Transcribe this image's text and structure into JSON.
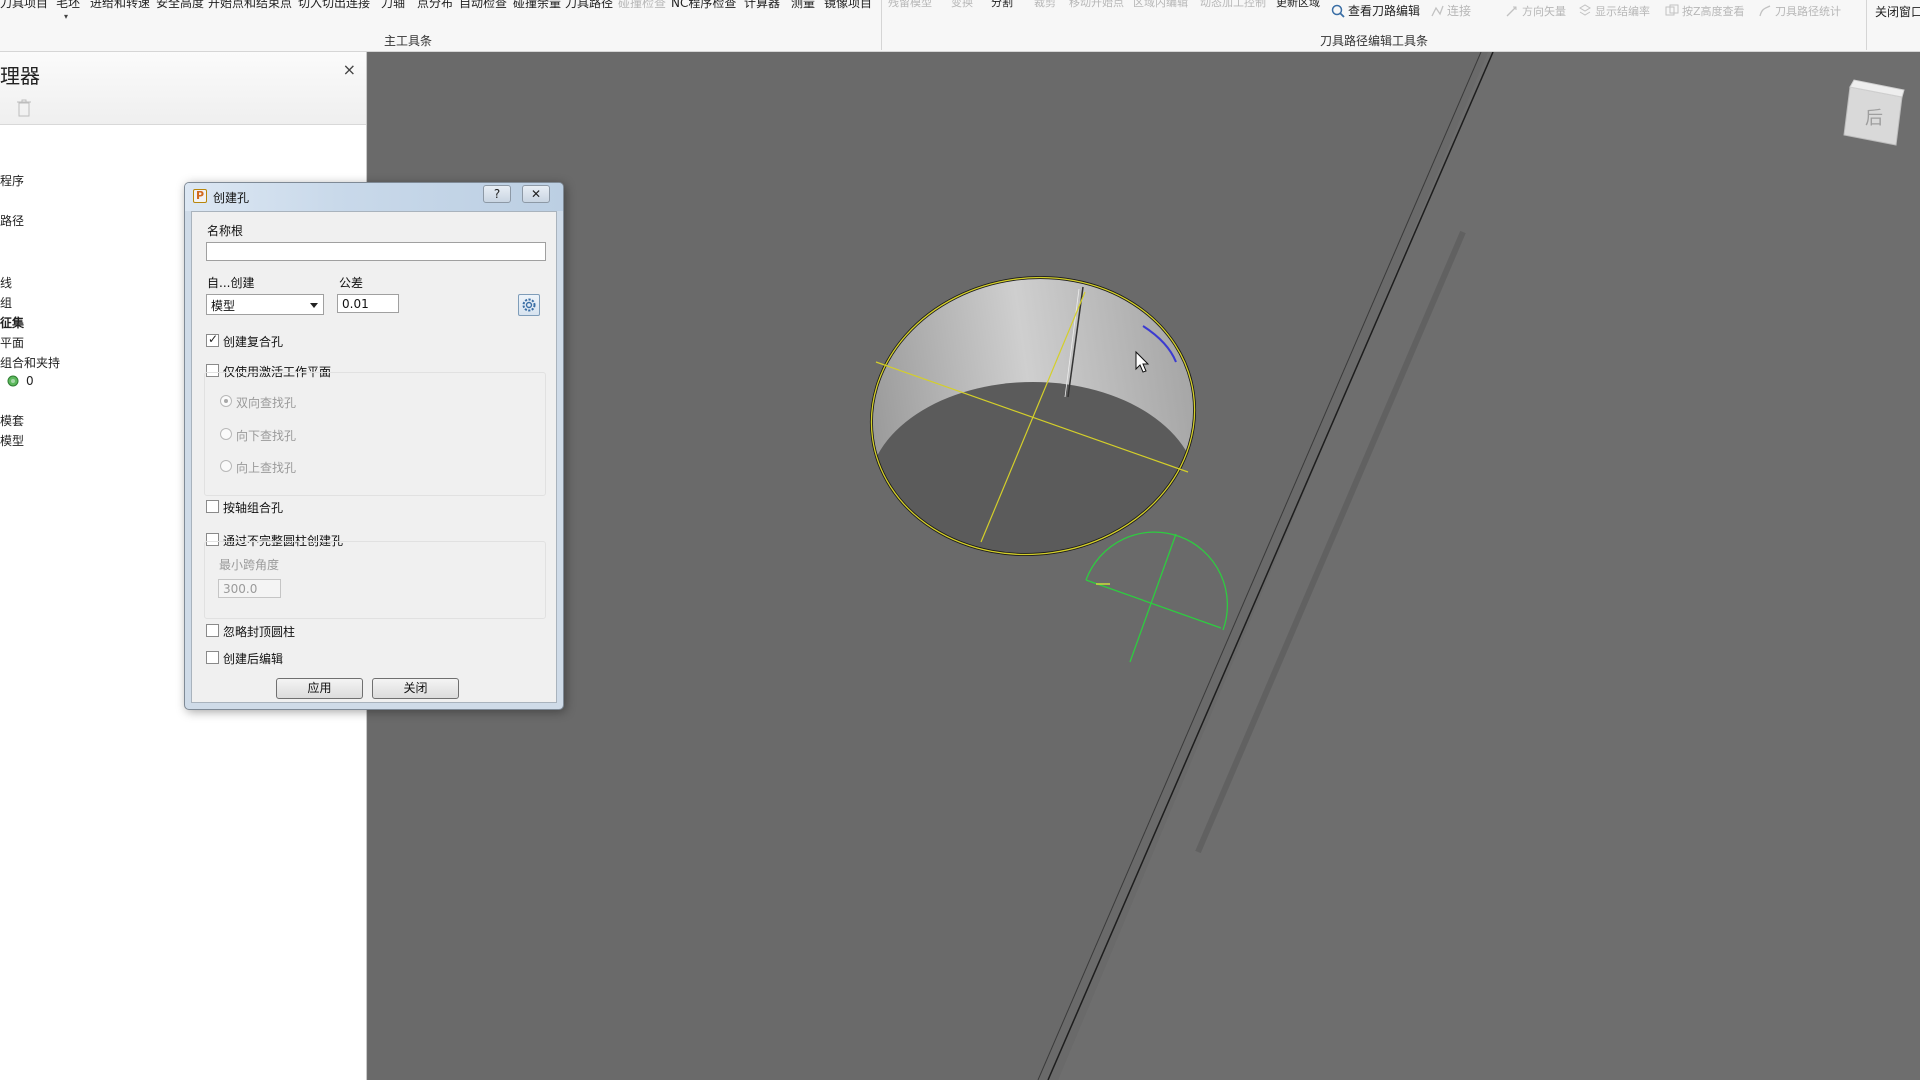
{
  "ribbon": {
    "left_items": [
      {
        "label": "刀具项目",
        "dis": false
      },
      {
        "label": "毛坯",
        "dis": false
      },
      {
        "label": "进给和转速",
        "dis": false
      },
      {
        "label": "安全高度",
        "dis": false
      },
      {
        "label": "开始点和结束点",
        "dis": false
      },
      {
        "label": "切入切出连接",
        "dis": false
      },
      {
        "label": "刀轴",
        "dis": false
      },
      {
        "label": "点分布",
        "dis": false
      },
      {
        "label": "自动检查",
        "dis": false
      },
      {
        "label": "碰撞余量",
        "dis": false
      },
      {
        "label": "刀具路径",
        "dis": false
      },
      {
        "label": "碰撞检查",
        "dis": true
      },
      {
        "label": "NC程序检查",
        "dis": false
      },
      {
        "label": "计算器",
        "dis": false
      },
      {
        "label": "测量",
        "dis": false
      },
      {
        "label": "镜像项目",
        "dis": false
      }
    ],
    "main_group_label": "主工具条",
    "edit_items": [
      {
        "label": "残留模型",
        "dis": true
      },
      {
        "label": "变换",
        "dis": true
      },
      {
        "label": "分割",
        "dis": false
      },
      {
        "label": "裁剪",
        "dis": true
      },
      {
        "label": "移动开始点",
        "dis": true
      },
      {
        "label": "区域内编辑",
        "dis": true
      },
      {
        "label": "动态加工控制",
        "dis": true
      },
      {
        "label": "更新区域",
        "dis": false
      }
    ],
    "view_toolpath_edit": "查看刀路编辑",
    "connect": "连接",
    "direction_vector": "方向矢量",
    "show_result": "显示结编率",
    "z_height_view": "按Z高度查看",
    "toolpath_stats": "刀具路径统计",
    "edit_group_label": "刀具路径编辑工具条",
    "close_window": "关闭窗口"
  },
  "explorer": {
    "title": "理器",
    "close": "×",
    "items": [
      {
        "label": "程序",
        "bold": false
      },
      {
        "label": "路径",
        "bold": false
      },
      {
        "label": "线",
        "bold": false
      },
      {
        "label": "组",
        "bold": false
      },
      {
        "label": "征集",
        "bold": true
      },
      {
        "label": "平面",
        "bold": false
      },
      {
        "label": "组合和夹持",
        "bold": false
      },
      {
        "label": "0",
        "bold": false
      },
      {
        "label": "模套",
        "bold": false
      },
      {
        "label": "模型",
        "bold": false
      }
    ]
  },
  "dialog": {
    "title": "创建孔",
    "help": "?",
    "close_x": "✕",
    "name_root_label": "名称根",
    "name_root_value": "",
    "create_from_label": "自...创建",
    "create_from_value": "模型",
    "tolerance_label": "公差",
    "tolerance_value": "0.01",
    "create_compound": {
      "label": "创建复合孔",
      "checked": true
    },
    "active_workplane_only": {
      "label": "仅使用激活工作平面",
      "checked": false
    },
    "radios": [
      {
        "label": "双向查找孔",
        "selected": true
      },
      {
        "label": "向下查找孔",
        "selected": false
      },
      {
        "label": "向上查找孔",
        "selected": false
      }
    ],
    "group_by_axis": {
      "label": "按轴组合孔",
      "checked": false
    },
    "partial_cylinder": {
      "label": "通过不完整圆柱创建孔",
      "checked": false
    },
    "min_span_label": "最小跨角度",
    "min_span_value": "300.0",
    "ignore_capped": {
      "label": "忽略封顶圆柱",
      "checked": false
    },
    "edit_after_create": {
      "label": "创建后编辑",
      "checked": false
    },
    "apply": "应用",
    "close": "关闭"
  },
  "colors": {
    "viewport_bg": "#6b6b6b",
    "hole_outline": "#d4cf2a",
    "workplane_green": "#2ecc40",
    "dialog_frame": "#cfdbe8"
  }
}
